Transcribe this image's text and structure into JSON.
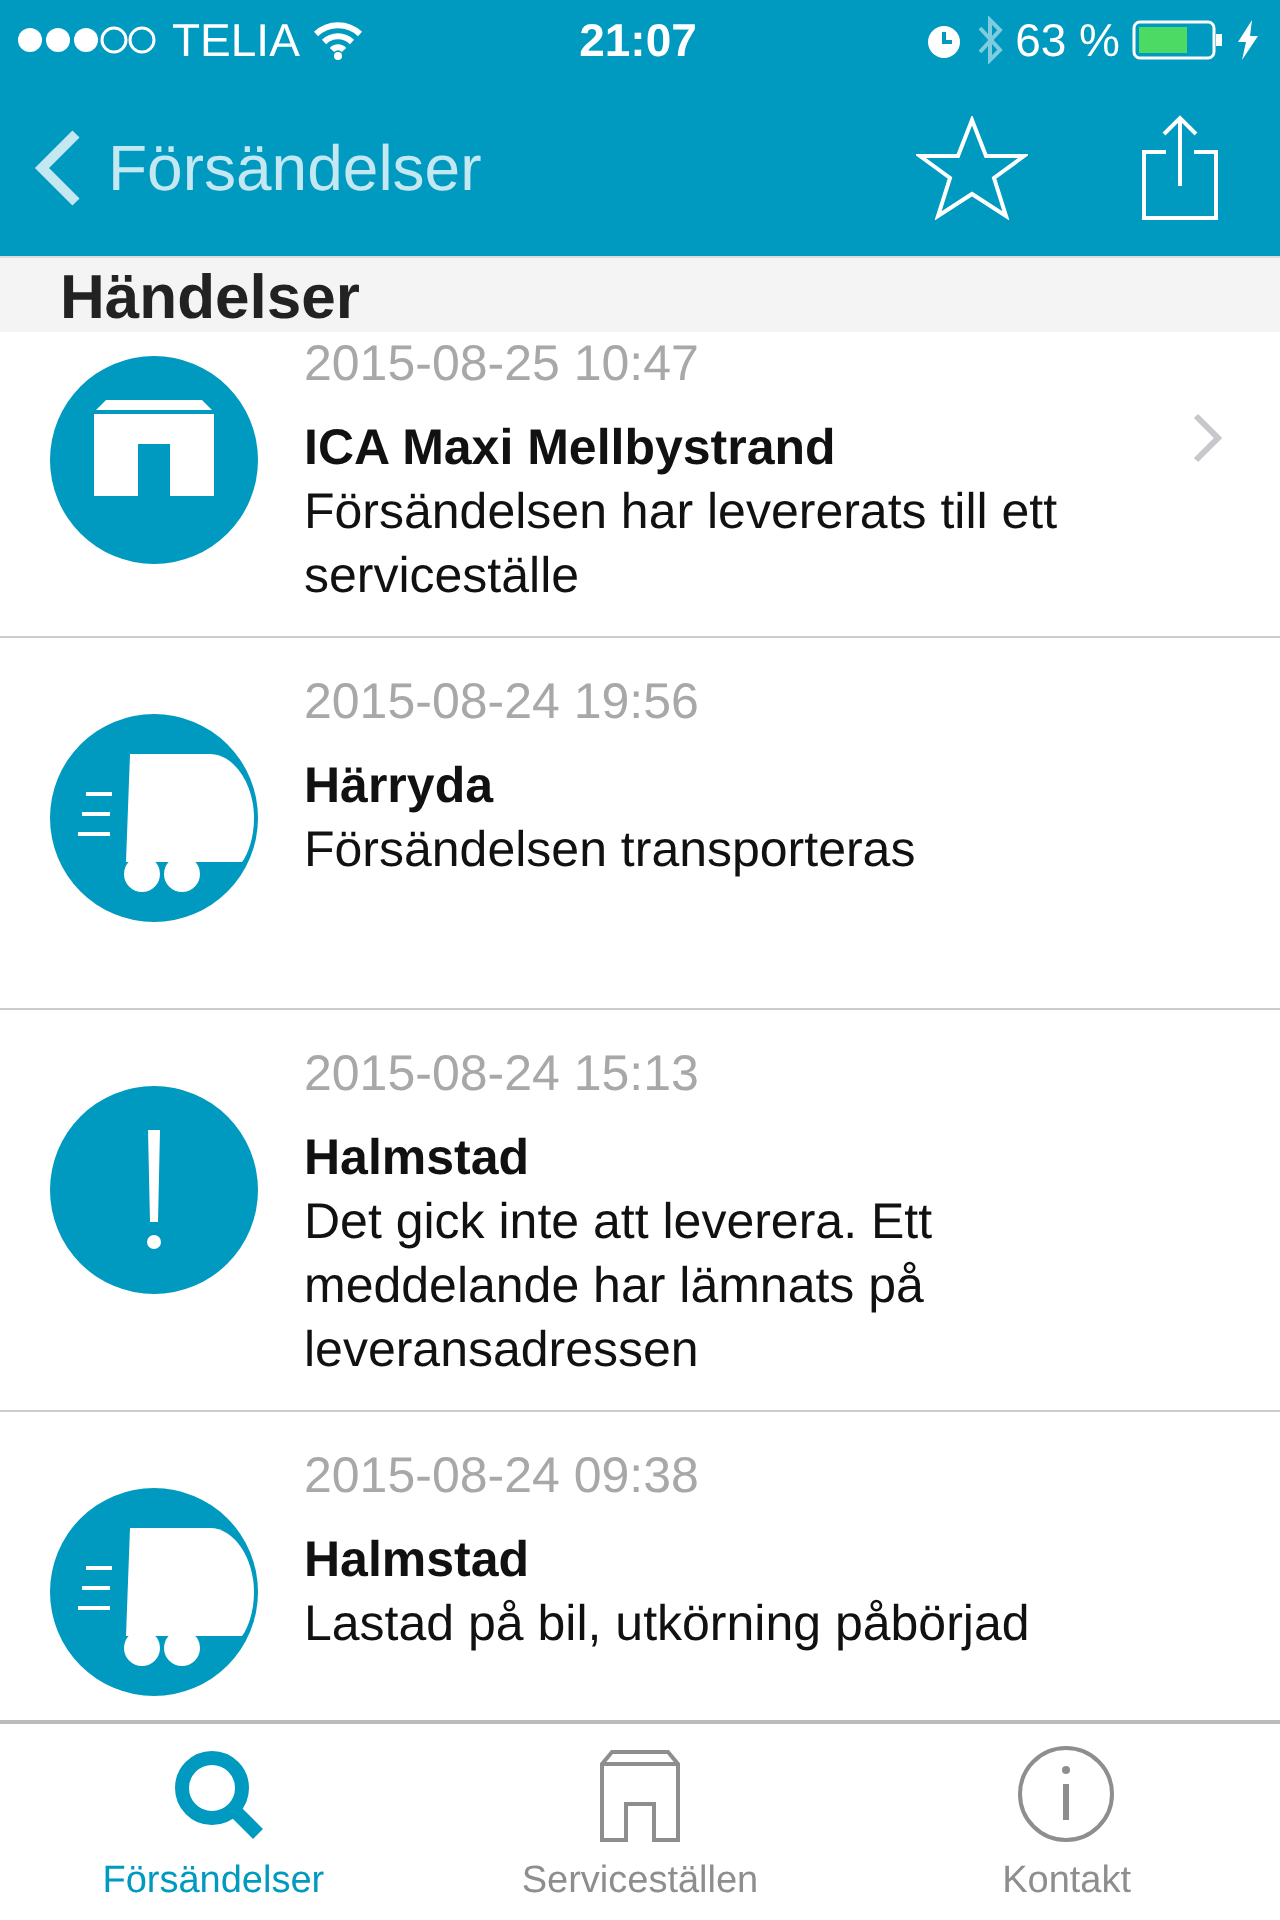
{
  "status_bar": {
    "carrier": "TELIA",
    "time": "21:07",
    "battery": "63 %"
  },
  "nav_bar": {
    "back_label": "Försändelser"
  },
  "section_header": "Händelser",
  "events": [
    {
      "kind": "store",
      "timestamp": "2015-08-25 10:47",
      "place": "ICA Maxi Mellbystrand",
      "message": "Försändelsen har levererats till ett serviceställe",
      "disclosure": true
    },
    {
      "kind": "truck",
      "timestamp": "2015-08-24 19:56",
      "place": "Härryda",
      "message": "Försändelsen transporteras",
      "disclosure": false
    },
    {
      "kind": "alert",
      "timestamp": "2015-08-24 15:13",
      "place": "Halmstad",
      "message": "Det gick inte att leverera. Ett meddelande har lämnats på leveransadressen",
      "disclosure": false
    },
    {
      "kind": "truck",
      "timestamp": "2015-08-24 09:38",
      "place": "Halmstad",
      "message": "Lastad på bil, utkörning påbörjad",
      "disclosure": false
    }
  ],
  "tab_bar": [
    {
      "kind": "search",
      "label": "Försändelser",
      "selected": true
    },
    {
      "kind": "store",
      "label": "Serviceställen",
      "selected": false
    },
    {
      "kind": "info",
      "label": "Kontakt",
      "selected": false
    }
  ]
}
